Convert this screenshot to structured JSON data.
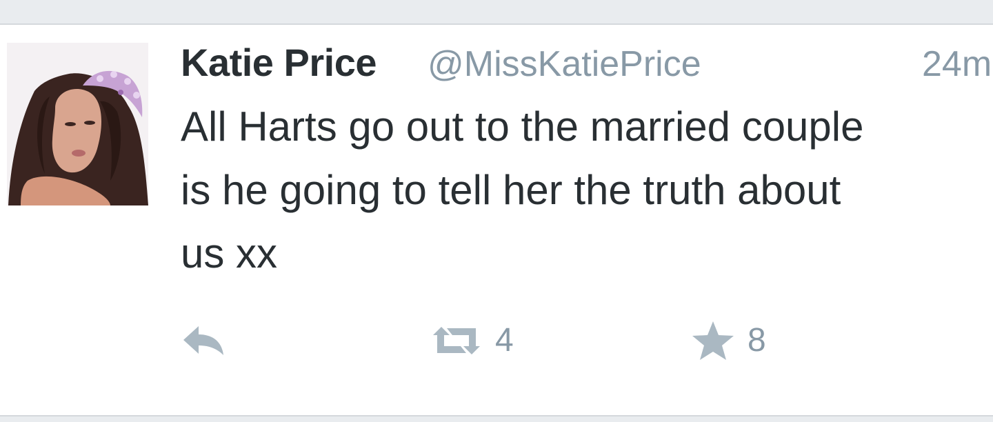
{
  "tweet": {
    "author": {
      "name": "Katie Price",
      "handle": "@MissKatiePrice"
    },
    "timestamp": "24m",
    "text_lines": [
      "All Harts go out to the married couple",
      "is he going to tell her the truth about",
      "us xx"
    ],
    "actions": {
      "reply_icon": "reply-icon",
      "retweet_icon": "retweet-icon",
      "retweet_count": "4",
      "favorite_icon": "star-icon",
      "favorite_count": "8"
    }
  },
  "colors": {
    "text": "#292f33",
    "muted": "#8899a6",
    "icon": "#aab8c2",
    "background": "#ffffff",
    "strip": "#e9ecef"
  }
}
